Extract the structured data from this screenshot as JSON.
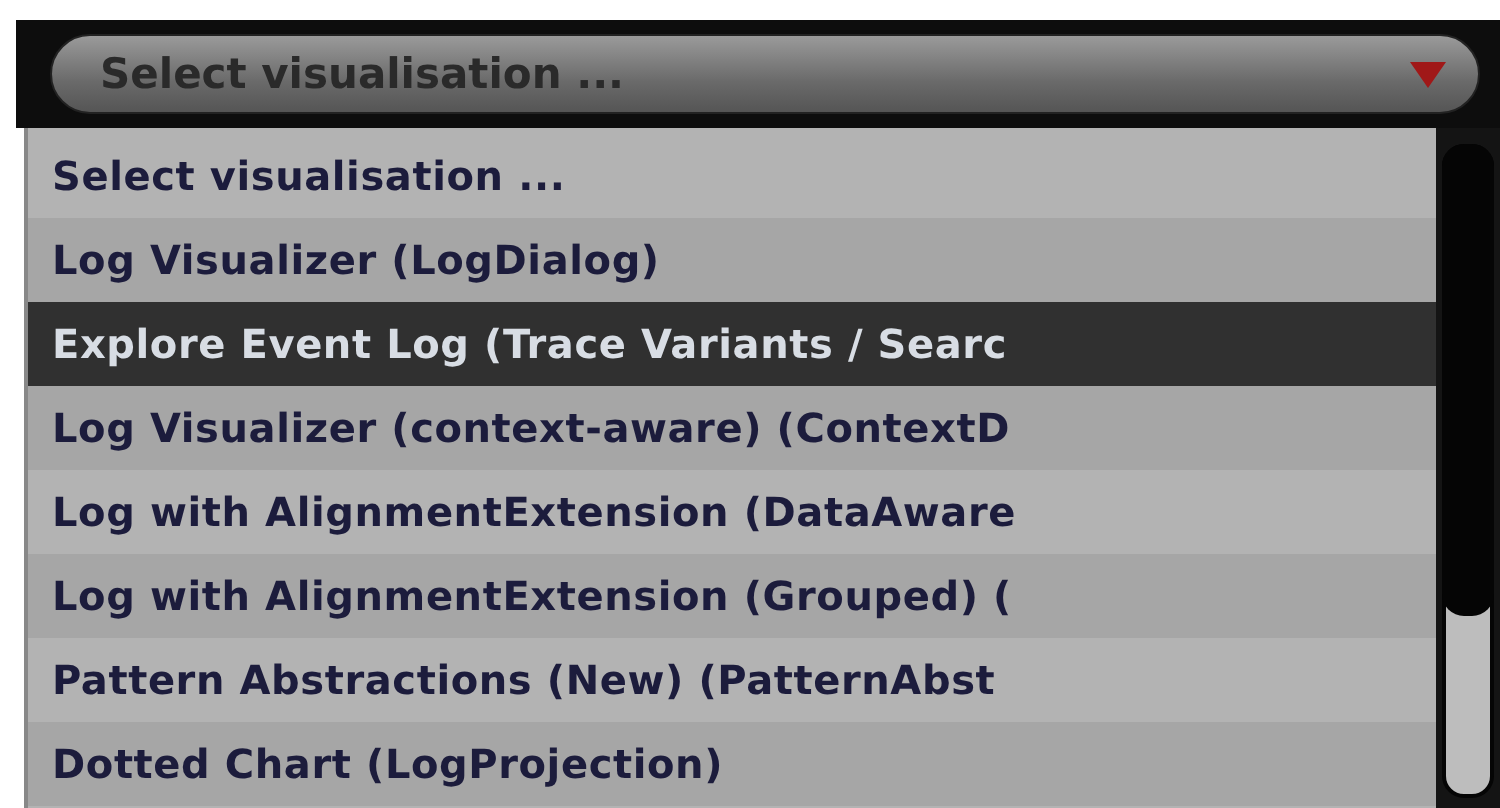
{
  "combo": {
    "value": "Select visualisation ..."
  },
  "options": [
    {
      "label": "Select visualisation ...",
      "selected": false
    },
    {
      "label": "Log Visualizer (LogDialog)",
      "selected": false
    },
    {
      "label": "Explore Event Log (Trace Variants / Searc",
      "selected": true
    },
    {
      "label": "Log Visualizer (context-aware) (ContextD",
      "selected": false
    },
    {
      "label": "Log with AlignmentExtension (DataAware",
      "selected": false
    },
    {
      "label": "Log with AlignmentExtension (Grouped) (",
      "selected": false
    },
    {
      "label": "Pattern Abstractions (New) (PatternAbst",
      "selected": false
    },
    {
      "label": "Dotted Chart (LogProjection)",
      "selected": false
    }
  ]
}
